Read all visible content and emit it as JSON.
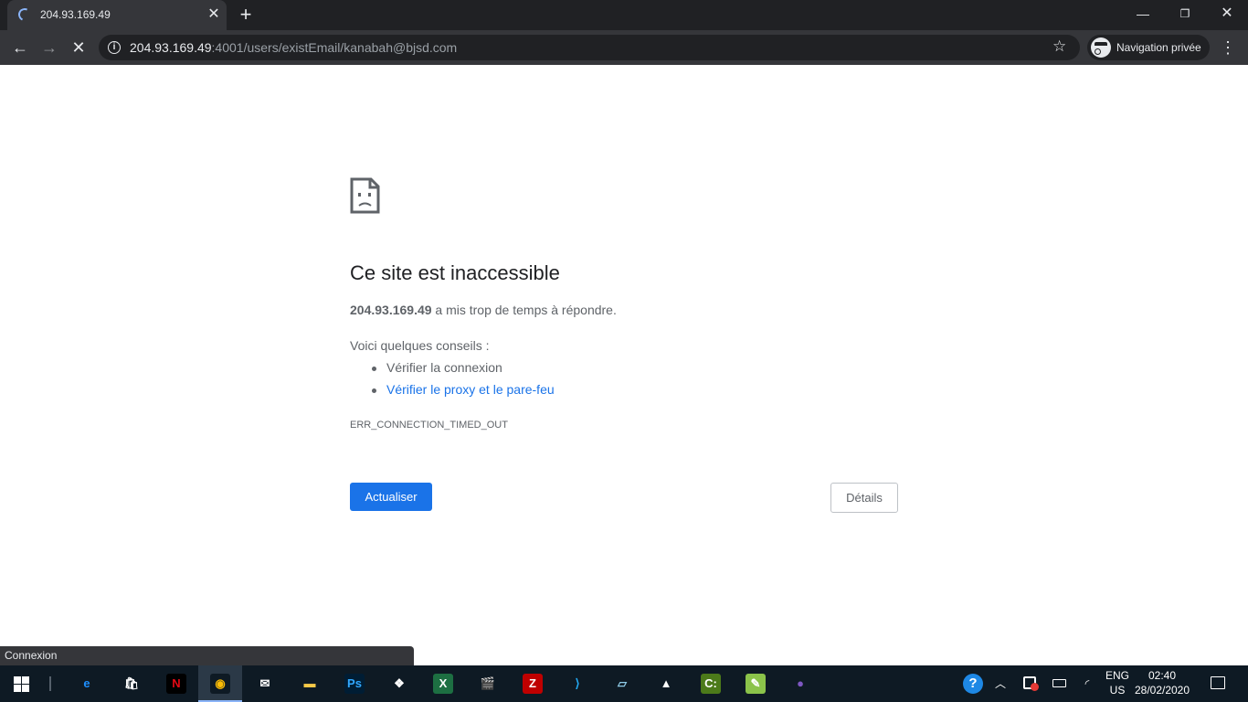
{
  "browser": {
    "tab": {
      "title": "204.93.169.49",
      "close_glyph": "✕"
    },
    "new_tab_glyph": "+",
    "window_controls": {
      "minimize": "—",
      "maximize": "❐",
      "close": "✕"
    },
    "nav": {
      "back": "←",
      "forward": "→",
      "stop": "✕"
    },
    "address": {
      "host": "204.93.169.49",
      "rest": ":4001/users/existEmail/kanabah@bjsd.com"
    },
    "star_glyph": "☆",
    "incognito_label": "Navigation privée",
    "menu_glyph": "⋮"
  },
  "error_page": {
    "title": "Ce site est inaccessible",
    "host_bold": "204.93.169.49",
    "description_rest": " a mis trop de temps à répondre.",
    "tips_title": "Voici quelques conseils :",
    "tips": [
      "Vérifier la connexion",
      "Vérifier le proxy et le pare-feu"
    ],
    "error_code": "ERR_CONNECTION_TIMED_OUT",
    "reload_label": "Actualiser",
    "details_label": "Détails"
  },
  "status_bubble": "Connexion",
  "taskbar": {
    "apps": [
      {
        "name": "edge",
        "glyph": "e",
        "bg": "#0e1a24",
        "fg": "#1e90ff"
      },
      {
        "name": "store",
        "glyph": "🛍",
        "bg": "#0e1a24",
        "fg": "#ffffff"
      },
      {
        "name": "netflix",
        "glyph": "N",
        "bg": "#000000",
        "fg": "#e50914"
      },
      {
        "name": "chrome",
        "glyph": "◉",
        "bg": "#0e1a24",
        "fg": "#fbbc05"
      },
      {
        "name": "mail",
        "glyph": "✉",
        "bg": "#0e1a24",
        "fg": "#ffffff"
      },
      {
        "name": "file-explorer",
        "glyph": "▬",
        "bg": "#0e1a24",
        "fg": "#f7c948"
      },
      {
        "name": "photoshop",
        "glyph": "Ps",
        "bg": "#001d34",
        "fg": "#31a8ff"
      },
      {
        "name": "dropbox",
        "glyph": "❖",
        "bg": "#0e1a24",
        "fg": "#ffffff"
      },
      {
        "name": "excel",
        "glyph": "X",
        "bg": "#1d6f42",
        "fg": "#ffffff"
      },
      {
        "name": "clapper",
        "glyph": "🎬",
        "bg": "#0e1a24",
        "fg": "#ffffff"
      },
      {
        "name": "filezilla",
        "glyph": "Z",
        "bg": "#bf0000",
        "fg": "#ffffff"
      },
      {
        "name": "vscode",
        "glyph": "⟩",
        "bg": "#0e1a24",
        "fg": "#23a9f2"
      },
      {
        "name": "notes",
        "glyph": "▱",
        "bg": "#0e1a24",
        "fg": "#8ecae6"
      },
      {
        "name": "photos",
        "glyph": "▲",
        "bg": "#0e1a24",
        "fg": "#ffffff"
      },
      {
        "name": "terminal",
        "glyph": "C:",
        "bg": "#4c7a1a",
        "fg": "#ffffff"
      },
      {
        "name": "notepad-plus",
        "glyph": "✎",
        "bg": "#8bc34a",
        "fg": "#ffffff"
      },
      {
        "name": "tor",
        "glyph": "●",
        "bg": "#0e1a24",
        "fg": "#7e57c2"
      }
    ],
    "lang": [
      "ENG",
      "US"
    ],
    "time": "02:40",
    "date": "28/02/2020"
  }
}
